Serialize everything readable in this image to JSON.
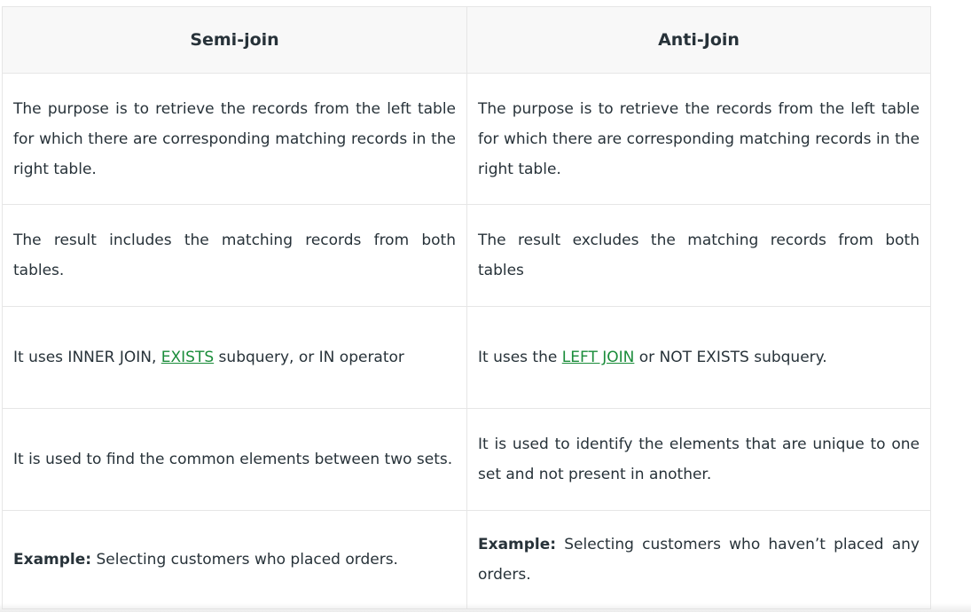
{
  "table": {
    "headers": [
      "Semi-join",
      "Anti-Join"
    ],
    "rows": [
      {
        "semi": "The purpose is to retrieve the records from the left table for which there are corresponding matching records in the right table.",
        "anti": "The purpose is to retrieve the records from the left table for which there are corresponding matching records in the right table."
      },
      {
        "semi": "The result includes the matching records from both tables.",
        "anti": "The result excludes the matching records from both tables"
      },
      {
        "semi_before": "It uses INNER JOIN, ",
        "semi_link": "EXISTS",
        "semi_after": " subquery, or IN operator",
        "anti_before": "It uses the ",
        "anti_link": "LEFT JOIN",
        "anti_after": " or NOT EXISTS subquery."
      },
      {
        "semi": "It is used to find the common elements between two sets.",
        "anti": "It is used to identify the elements that are unique to one set and not present in another."
      },
      {
        "semi_label": "Example:",
        "semi_text": " Selecting customers who placed orders.",
        "anti_label": "Example:",
        "anti_text": " Selecting customers who haven’t placed any orders."
      }
    ]
  },
  "colors": {
    "header_bg": "#f8f8f8",
    "border": "#e6e6e6",
    "text": "#273239",
    "link": "#1a8c3a"
  }
}
